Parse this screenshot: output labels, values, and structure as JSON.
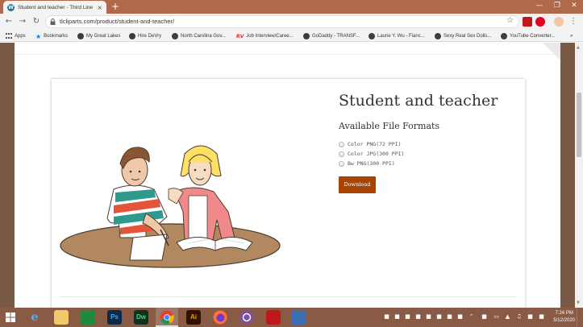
{
  "browser": {
    "tab_title": "Student and teacher - Third Line",
    "tab_close": "×",
    "new_tab": "+",
    "url": "tlcliparts.com/product/student-and-teacher/",
    "bookmarks": [
      {
        "label": "Apps",
        "icon": "apps-grid-icon"
      },
      {
        "label": "Bookmarks",
        "icon": "star-icon"
      },
      {
        "label": "My Great Lakes",
        "icon": "globe-icon"
      },
      {
        "label": "Hire DeVry",
        "icon": "globe-icon"
      },
      {
        "label": "North Carolina Gov...",
        "icon": "globe-icon"
      },
      {
        "label": "Job Interview/Caree...",
        "icon": "rv-icon"
      },
      {
        "label": "GoDaddy - TRANSF...",
        "icon": "globe-icon"
      },
      {
        "label": "Laurie Y. Wu - Fianc...",
        "icon": "globe-icon"
      },
      {
        "label": "Sexy Real Sex Dolls...",
        "icon": "globe-icon"
      },
      {
        "label": "YouTube Converter...",
        "icon": "globe-icon"
      }
    ],
    "bookmarks_more": "»"
  },
  "product": {
    "title": "Student and teacher",
    "formats_heading": "Available File Formats",
    "options": [
      {
        "label": "Color PNG(72 PPI)"
      },
      {
        "label": "Color JPG(300 PPI)"
      },
      {
        "label": "Bw PNG(300 PPI)"
      }
    ],
    "download_label": "Download",
    "button_color": "#a94300"
  },
  "taskbar": {
    "time": "7:24 PM",
    "date": "5/12/2020",
    "apps": [
      {
        "name": "windows-start",
        "text": ""
      },
      {
        "name": "internet-explorer",
        "text": "e"
      },
      {
        "name": "file-explorer",
        "text": ""
      },
      {
        "name": "store",
        "text": ""
      },
      {
        "name": "photoshop",
        "text": "Ps"
      },
      {
        "name": "dreamweaver",
        "text": "Dw"
      },
      {
        "name": "chrome",
        "text": ""
      },
      {
        "name": "illustrator",
        "text": "Ai"
      },
      {
        "name": "firefox",
        "text": ""
      },
      {
        "name": "viber",
        "text": ""
      },
      {
        "name": "mcafee",
        "text": ""
      },
      {
        "name": "photos",
        "text": ""
      }
    ]
  },
  "colors": {
    "accent": "#a94300",
    "page_background": "#7b5a45",
    "titlebar": "#b06a49",
    "taskbar": "#8a5b44"
  }
}
